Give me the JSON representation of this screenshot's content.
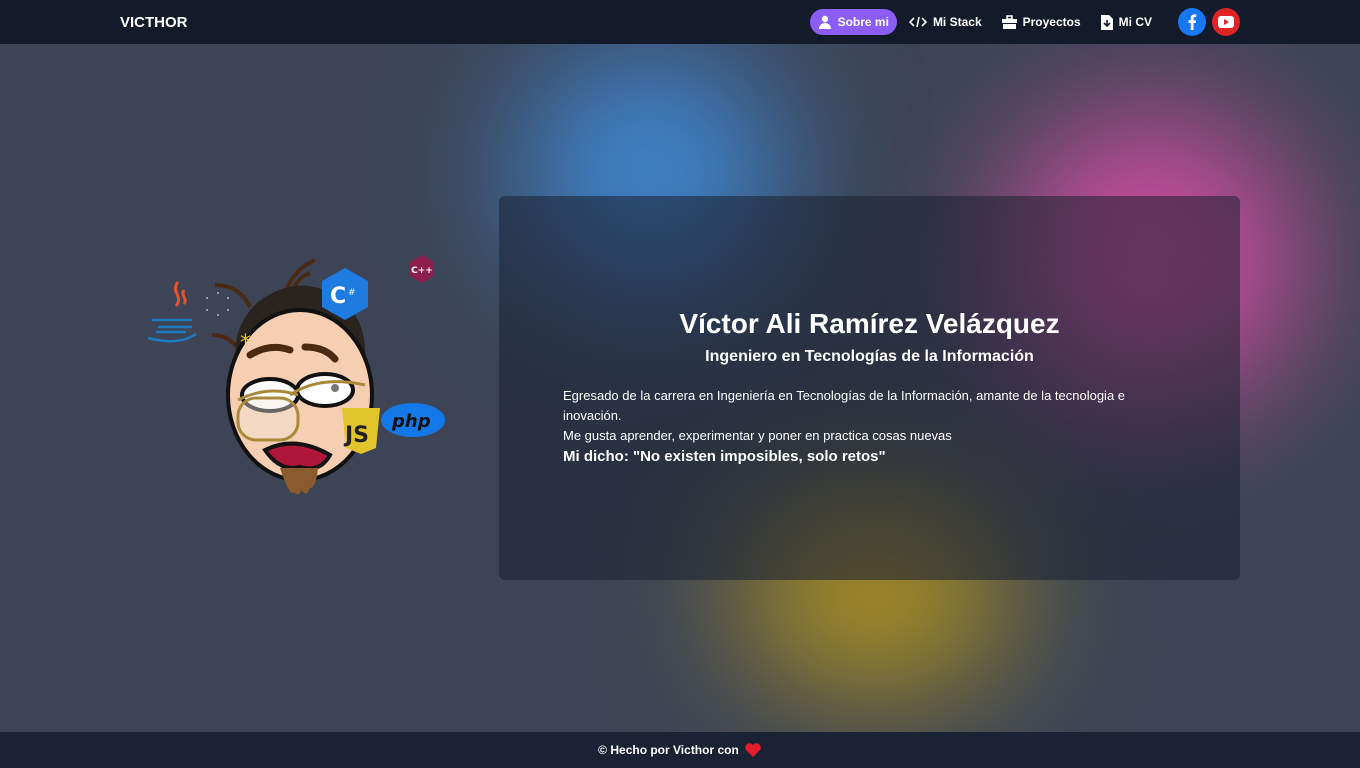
{
  "nav": {
    "brand": "VICTHOR",
    "links": [
      {
        "label": "Sobre mi",
        "icon": "user-icon",
        "active": true
      },
      {
        "label": "Mi Stack",
        "icon": "code-icon"
      },
      {
        "label": "Proyectos",
        "icon": "briefcase-icon"
      },
      {
        "label": "Mi CV",
        "icon": "file-download-icon"
      }
    ],
    "social": [
      {
        "name": "facebook-icon",
        "color": "#1877f2"
      },
      {
        "name": "youtube-icon",
        "color": "#e02424"
      }
    ],
    "accent": "#8b5cf6"
  },
  "profile": {
    "name": "Víctor Ali Ramírez Velázquez",
    "title": "Ingeniero en Tecnologías de la Información",
    "paragraph1": "Egresado de la carrera en Ingeniería en Tecnologías de la Información, amante de la tecnologia e inovación.",
    "paragraph2": "Me gusta aprender, experimentar y poner en practica cosas nuevas",
    "motto": "Mi dicho: \"No existen imposibles, solo retos\""
  },
  "avatar": {
    "badges": [
      "java",
      "C#",
      "C++",
      "JS",
      "php"
    ]
  },
  "footer": {
    "text": "© Hecho por Victhor con",
    "icon": "heart-icon",
    "heart_color": "#e11d2a"
  }
}
